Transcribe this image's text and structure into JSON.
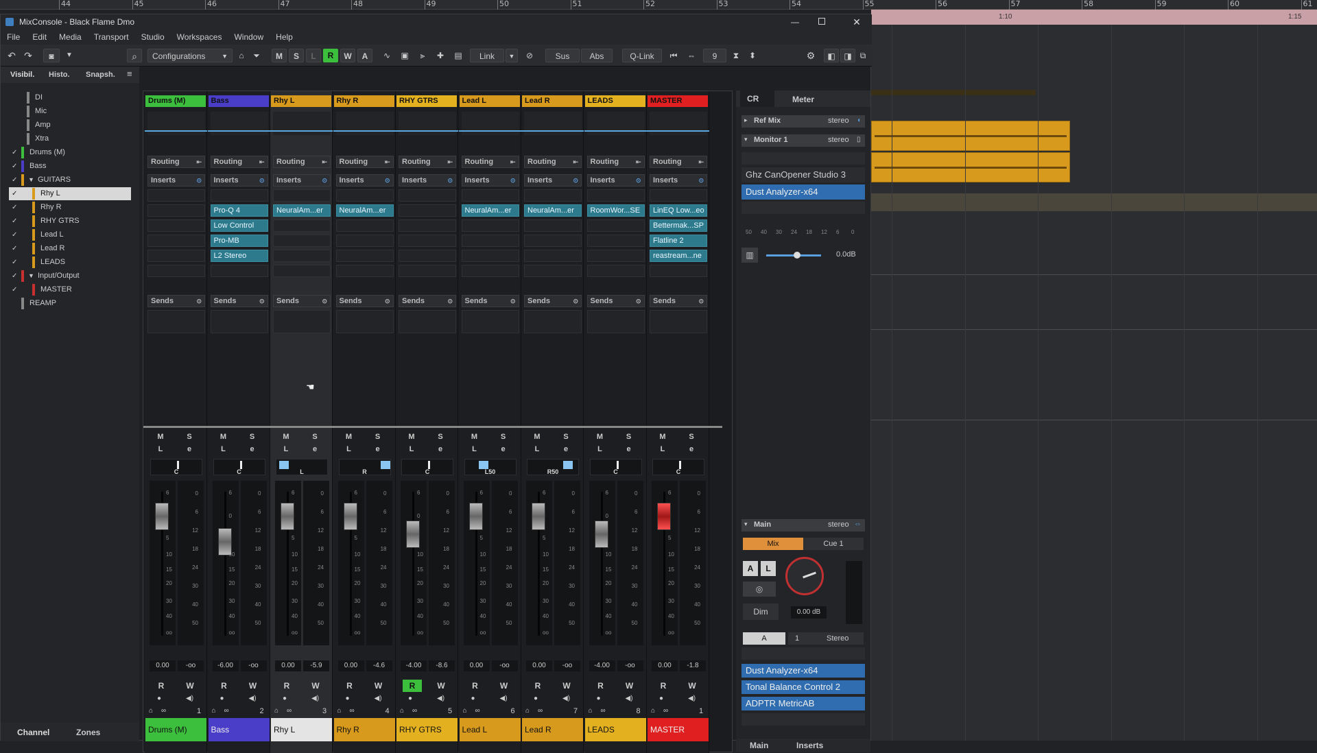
{
  "app": {
    "title": "MixConsole - Black Flame Dmo"
  },
  "ruler": {
    "bars": [
      "44",
      "45",
      "46",
      "47",
      "48",
      "49",
      "50",
      "51",
      "52",
      "53",
      "54",
      "55",
      "56",
      "57",
      "58",
      "59",
      "60",
      "61"
    ],
    "markers": [
      "1:10",
      "1:15"
    ]
  },
  "menu": [
    "File",
    "Edit",
    "Media",
    "Transport",
    "Studio",
    "Workspaces",
    "Window",
    "Help"
  ],
  "toolbar": {
    "configurations": "Configurations",
    "buttons": [
      "M",
      "S",
      "L",
      "R",
      "W",
      "A"
    ],
    "link": "Link",
    "sus": "Sus",
    "abs": "Abs",
    "qlink": "Q-Link",
    "count": "9"
  },
  "left_tabs": [
    "Visibil.",
    "Histo.",
    "Snapsh."
  ],
  "bottom_tabs": [
    "Channel",
    "Zones"
  ],
  "visibility": [
    {
      "label": "DI",
      "check": "",
      "color": "#888"
    },
    {
      "label": "Mic",
      "check": "",
      "color": "#888"
    },
    {
      "label": "Amp",
      "check": "",
      "color": "#888"
    },
    {
      "label": "Xtra",
      "check": "",
      "color": "#888"
    },
    {
      "label": "Drums (M)",
      "check": "✓",
      "color": "#3cbf3c"
    },
    {
      "label": "Bass",
      "check": "✓",
      "color": "#4a3ec8"
    },
    {
      "label": "GUITARS",
      "check": "✓",
      "color": "#d89a1c"
    },
    {
      "label": "Rhy L",
      "check": "✓",
      "color": "#d89a1c"
    },
    {
      "label": "Rhy R",
      "check": "✓",
      "color": "#d89a1c"
    },
    {
      "label": "RHY GTRS",
      "check": "✓",
      "color": "#d89a1c"
    },
    {
      "label": "Lead L",
      "check": "✓",
      "color": "#d89a1c"
    },
    {
      "label": "Lead R",
      "check": "✓",
      "color": "#d89a1c"
    },
    {
      "label": "LEADS",
      "check": "✓",
      "color": "#d89a1c"
    },
    {
      "label": "Input/Output",
      "check": "✓",
      "color": "#c83030"
    },
    {
      "label": "MASTER",
      "check": "✓",
      "color": "#c83030"
    },
    {
      "label": "REAMP",
      "check": "",
      "color": "#888"
    }
  ],
  "rack_labels": {
    "routing": "Routing",
    "inserts": "Inserts",
    "sends": "Sends"
  },
  "strip_buttons": {
    "m": "M",
    "s": "S",
    "l": "L",
    "e": "e",
    "r": "R",
    "w": "W"
  },
  "channels": [
    {
      "name": "Drums (M)",
      "color": "#3cbf3c",
      "inserts": [
        "",
        "",
        "",
        "",
        ""
      ],
      "pan": "C",
      "vol": "0.00",
      "peak": "-oo",
      "num": "1",
      "fader_db": 0
    },
    {
      "name": "Bass",
      "color": "#4a3ec8",
      "inserts": [
        "Pro-Q 4",
        "Low Control",
        "Pro-MB",
        "L2 Stereo",
        ""
      ],
      "pan": "C",
      "vol": "-6.00",
      "peak": "-oo",
      "num": "2",
      "fader_db": -6
    },
    {
      "name": "Rhy L",
      "color": "#d89a1c",
      "inserts": [
        "NeuralAm...er",
        "",
        "",
        "",
        ""
      ],
      "pan": "L",
      "vol": "0.00",
      "peak": "-5.9",
      "num": "3",
      "fader_db": 0
    },
    {
      "name": "Rhy R",
      "color": "#d89a1c",
      "inserts": [
        "NeuralAm...er",
        "",
        "",
        "",
        ""
      ],
      "pan": "R",
      "vol": "0.00",
      "peak": "-4.6",
      "num": "4",
      "fader_db": 0
    },
    {
      "name": "RHY GTRS",
      "color": "#e3b020",
      "inserts": [
        "",
        "",
        "",
        "",
        ""
      ],
      "pan": "C",
      "vol": "-4.00",
      "peak": "-8.6",
      "num": "5",
      "fader_db": -4
    },
    {
      "name": "Lead L",
      "color": "#d89a1c",
      "inserts": [
        "NeuralAm...er",
        "",
        "",
        "",
        ""
      ],
      "pan": "L50",
      "vol": "0.00",
      "peak": "-oo",
      "num": "6",
      "fader_db": 0
    },
    {
      "name": "Lead R",
      "color": "#d89a1c",
      "inserts": [
        "NeuralAm...er",
        "",
        "",
        "",
        ""
      ],
      "pan": "R50",
      "vol": "0.00",
      "peak": "-oo",
      "num": "7",
      "fader_db": 0
    },
    {
      "name": "LEADS",
      "color": "#e3b020",
      "inserts": [
        "RoomWor...SE",
        "",
        "",
        "",
        ""
      ],
      "pan": "C",
      "vol": "-4.00",
      "peak": "-oo",
      "num": "8",
      "fader_db": -4
    },
    {
      "name": "MASTER",
      "color": "#e02020",
      "inserts": [
        "LinEQ Low...eo",
        "Bettermak...SP",
        "Flatline 2",
        "reastream...ne",
        ""
      ],
      "pan": "C",
      "vol": "0.00",
      "peak": "-1.8",
      "num": "1",
      "fader_db": 0
    }
  ],
  "fader_scale": [
    "6",
    "0",
    "5",
    "10",
    "15",
    "20",
    "30",
    "40",
    "oo"
  ],
  "meter_scale": [
    "0",
    "6",
    "12",
    "18",
    "24",
    "30",
    "40",
    "50"
  ],
  "control_room": {
    "tabs": [
      "CR",
      "Meter"
    ],
    "ref_mix": "Ref Mix",
    "monitor": "Monitor 1",
    "stereo": "stereo",
    "monitor_plugins": [
      "Ghz CanOpener Studio 3",
      "Dust Analyzer-x64"
    ],
    "meter_scale": [
      "50",
      "40",
      "30",
      "24",
      "18",
      "12",
      "6",
      "0"
    ],
    "level": "0.0dB",
    "main": "Main",
    "mix": "Mix",
    "cue": "Cue 1",
    "dim": "Dim",
    "dim_val": "0.00 dB",
    "a": "A",
    "one": "1",
    "stereo_btn": "Stereo",
    "main_plugins": [
      "Dust Analyzer-x64",
      "Tonal Balance Control 2",
      "ADPTR MetricAB"
    ],
    "bottom_tabs": [
      "Main",
      "Inserts"
    ]
  }
}
